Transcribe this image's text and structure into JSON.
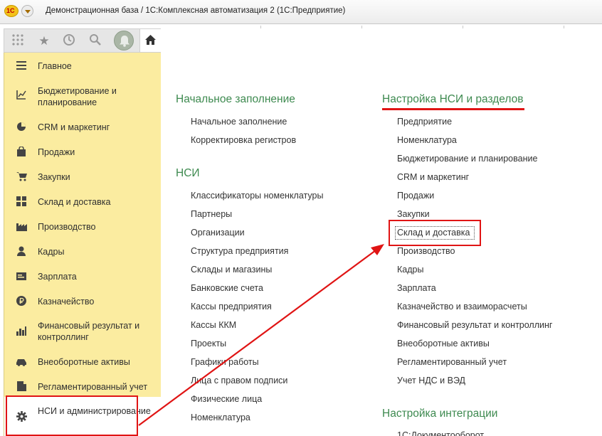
{
  "window": {
    "title": "Демонстрационная база / 1С:Комплексная автоматизация 2  (1С:Предприятие)",
    "logo_text": "1С"
  },
  "toolbar": {
    "icons": [
      "apps-grid-icon",
      "favorites-star-icon",
      "history-icon",
      "search-icon",
      "notifications-bell-icon",
      "home-icon"
    ]
  },
  "sidebar": {
    "items": [
      {
        "label": "Главное",
        "icon": "menu-lines-icon"
      },
      {
        "label": "Бюджетирование и планирование",
        "icon": "budget-chart-icon"
      },
      {
        "label": "CRM и маркетинг",
        "icon": "pie-chart-icon"
      },
      {
        "label": "Продажи",
        "icon": "shopping-bag-icon"
      },
      {
        "label": "Закупки",
        "icon": "cart-icon"
      },
      {
        "label": "Склад и доставка",
        "icon": "warehouse-grid-icon"
      },
      {
        "label": "Производство",
        "icon": "factory-icon"
      },
      {
        "label": "Кадры",
        "icon": "person-icon"
      },
      {
        "label": "Зарплата",
        "icon": "salary-icon"
      },
      {
        "label": "Казначейство",
        "icon": "ruble-coin-icon"
      },
      {
        "label": "Финансовый результат и контроллинг",
        "icon": "bar-chart-icon"
      },
      {
        "label": "Внеоборотные активы",
        "icon": "car-icon"
      },
      {
        "label": "Регламентированный учет",
        "icon": "document-icon"
      },
      {
        "label": "НСИ и администрирование",
        "icon": "gear-icon"
      }
    ]
  },
  "main": {
    "col1": {
      "sections": [
        {
          "title": "Начальное заполнение",
          "links": [
            "Начальное заполнение",
            "Корректировка регистров"
          ]
        },
        {
          "title": "НСИ",
          "links": [
            "Классификаторы номенклатуры",
            "Партнеры",
            "Организации",
            "Структура предприятия",
            "Склады и магазины",
            "Банковские счета",
            "Кассы предприятия",
            "Кассы ККМ",
            "Проекты",
            "Графики работы",
            "Лица с правом подписи",
            "Физические лица",
            "Номенклатура"
          ]
        }
      ]
    },
    "col2": {
      "sections": [
        {
          "title": "Настройка НСИ и разделов",
          "links": [
            "Предприятие",
            "Номенклатура",
            "Бюджетирование и планирование",
            "CRM и маркетинг",
            "Продажи",
            "Закупки",
            "Склад и доставка",
            "Производство",
            "Кадры",
            "Зарплата",
            "Казначейство и взаиморасчеты",
            "Финансовый результат и контроллинг",
            "Внеоборотные активы",
            "Регламентированный учет",
            "Учет НДС и ВЭД"
          ]
        },
        {
          "title": "Настройка интеграции",
          "links": [
            "1С:Документооборот"
          ]
        }
      ]
    }
  },
  "annotation_color": "#e01414",
  "section_title_color": "#3e8a50",
  "sidebar_color": "#fbeca0"
}
